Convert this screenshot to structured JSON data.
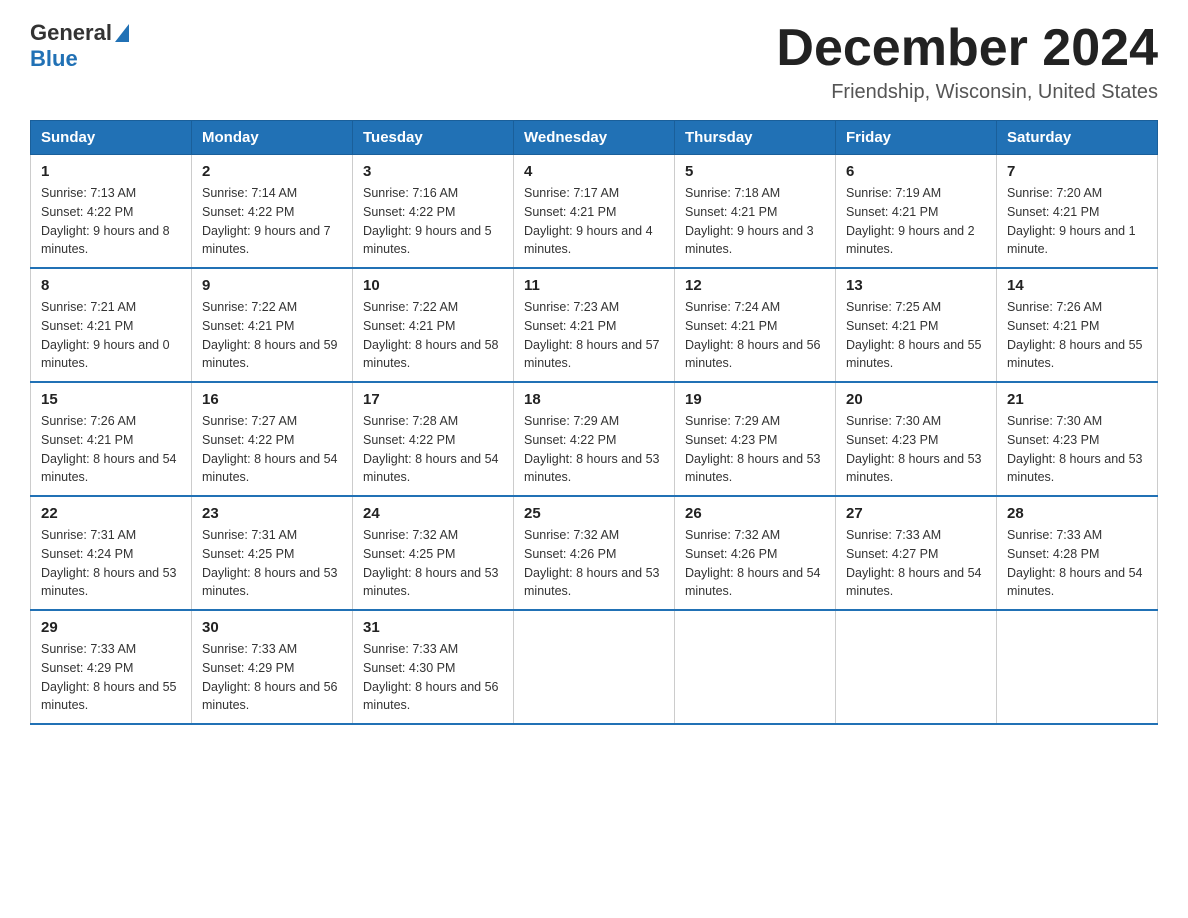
{
  "header": {
    "logo": {
      "general": "General",
      "blue": "Blue"
    },
    "title": "December 2024",
    "subtitle": "Friendship, Wisconsin, United States"
  },
  "weekdays": [
    "Sunday",
    "Monday",
    "Tuesday",
    "Wednesday",
    "Thursday",
    "Friday",
    "Saturday"
  ],
  "weeks": [
    [
      {
        "day": "1",
        "sunrise": "7:13 AM",
        "sunset": "4:22 PM",
        "daylight": "9 hours and 8 minutes."
      },
      {
        "day": "2",
        "sunrise": "7:14 AM",
        "sunset": "4:22 PM",
        "daylight": "9 hours and 7 minutes."
      },
      {
        "day": "3",
        "sunrise": "7:16 AM",
        "sunset": "4:22 PM",
        "daylight": "9 hours and 5 minutes."
      },
      {
        "day": "4",
        "sunrise": "7:17 AM",
        "sunset": "4:21 PM",
        "daylight": "9 hours and 4 minutes."
      },
      {
        "day": "5",
        "sunrise": "7:18 AM",
        "sunset": "4:21 PM",
        "daylight": "9 hours and 3 minutes."
      },
      {
        "day": "6",
        "sunrise": "7:19 AM",
        "sunset": "4:21 PM",
        "daylight": "9 hours and 2 minutes."
      },
      {
        "day": "7",
        "sunrise": "7:20 AM",
        "sunset": "4:21 PM",
        "daylight": "9 hours and 1 minute."
      }
    ],
    [
      {
        "day": "8",
        "sunrise": "7:21 AM",
        "sunset": "4:21 PM",
        "daylight": "9 hours and 0 minutes."
      },
      {
        "day": "9",
        "sunrise": "7:22 AM",
        "sunset": "4:21 PM",
        "daylight": "8 hours and 59 minutes."
      },
      {
        "day": "10",
        "sunrise": "7:22 AM",
        "sunset": "4:21 PM",
        "daylight": "8 hours and 58 minutes."
      },
      {
        "day": "11",
        "sunrise": "7:23 AM",
        "sunset": "4:21 PM",
        "daylight": "8 hours and 57 minutes."
      },
      {
        "day": "12",
        "sunrise": "7:24 AM",
        "sunset": "4:21 PM",
        "daylight": "8 hours and 56 minutes."
      },
      {
        "day": "13",
        "sunrise": "7:25 AM",
        "sunset": "4:21 PM",
        "daylight": "8 hours and 55 minutes."
      },
      {
        "day": "14",
        "sunrise": "7:26 AM",
        "sunset": "4:21 PM",
        "daylight": "8 hours and 55 minutes."
      }
    ],
    [
      {
        "day": "15",
        "sunrise": "7:26 AM",
        "sunset": "4:21 PM",
        "daylight": "8 hours and 54 minutes."
      },
      {
        "day": "16",
        "sunrise": "7:27 AM",
        "sunset": "4:22 PM",
        "daylight": "8 hours and 54 minutes."
      },
      {
        "day": "17",
        "sunrise": "7:28 AM",
        "sunset": "4:22 PM",
        "daylight": "8 hours and 54 minutes."
      },
      {
        "day": "18",
        "sunrise": "7:29 AM",
        "sunset": "4:22 PM",
        "daylight": "8 hours and 53 minutes."
      },
      {
        "day": "19",
        "sunrise": "7:29 AM",
        "sunset": "4:23 PM",
        "daylight": "8 hours and 53 minutes."
      },
      {
        "day": "20",
        "sunrise": "7:30 AM",
        "sunset": "4:23 PM",
        "daylight": "8 hours and 53 minutes."
      },
      {
        "day": "21",
        "sunrise": "7:30 AM",
        "sunset": "4:23 PM",
        "daylight": "8 hours and 53 minutes."
      }
    ],
    [
      {
        "day": "22",
        "sunrise": "7:31 AM",
        "sunset": "4:24 PM",
        "daylight": "8 hours and 53 minutes."
      },
      {
        "day": "23",
        "sunrise": "7:31 AM",
        "sunset": "4:25 PM",
        "daylight": "8 hours and 53 minutes."
      },
      {
        "day": "24",
        "sunrise": "7:32 AM",
        "sunset": "4:25 PM",
        "daylight": "8 hours and 53 minutes."
      },
      {
        "day": "25",
        "sunrise": "7:32 AM",
        "sunset": "4:26 PM",
        "daylight": "8 hours and 53 minutes."
      },
      {
        "day": "26",
        "sunrise": "7:32 AM",
        "sunset": "4:26 PM",
        "daylight": "8 hours and 54 minutes."
      },
      {
        "day": "27",
        "sunrise": "7:33 AM",
        "sunset": "4:27 PM",
        "daylight": "8 hours and 54 minutes."
      },
      {
        "day": "28",
        "sunrise": "7:33 AM",
        "sunset": "4:28 PM",
        "daylight": "8 hours and 54 minutes."
      }
    ],
    [
      {
        "day": "29",
        "sunrise": "7:33 AM",
        "sunset": "4:29 PM",
        "daylight": "8 hours and 55 minutes."
      },
      {
        "day": "30",
        "sunrise": "7:33 AM",
        "sunset": "4:29 PM",
        "daylight": "8 hours and 56 minutes."
      },
      {
        "day": "31",
        "sunrise": "7:33 AM",
        "sunset": "4:30 PM",
        "daylight": "8 hours and 56 minutes."
      },
      null,
      null,
      null,
      null
    ]
  ]
}
